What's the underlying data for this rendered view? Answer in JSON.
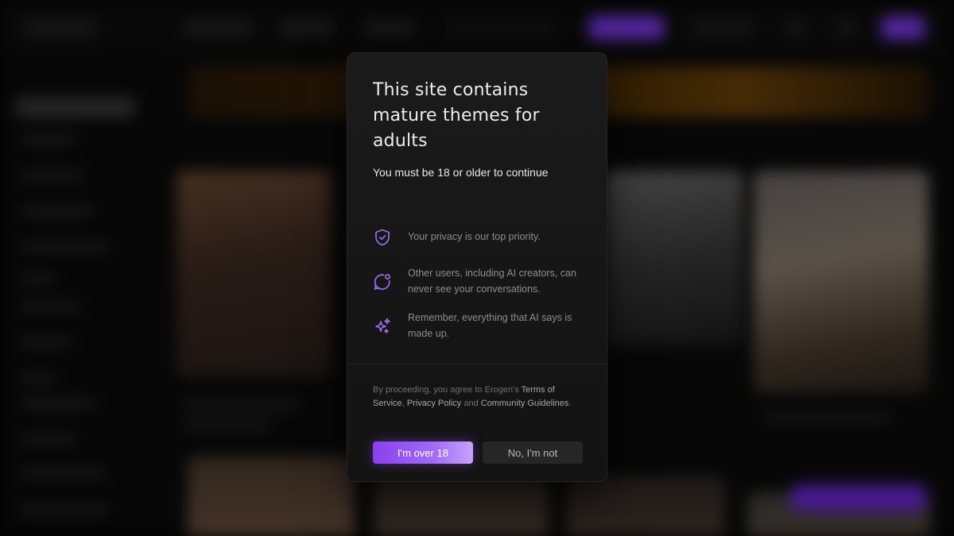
{
  "modal": {
    "title": "This site contains mature themes for adults",
    "subtitle": "You must be 18 or older to continue",
    "features": [
      {
        "icon": "shield-check-icon",
        "text": "Your privacy is our top priority."
      },
      {
        "icon": "chat-bubble-icon",
        "text": "Other users, including AI creators, can never see your conversations."
      },
      {
        "icon": "sparkles-icon",
        "text": "Remember, everything that AI says is made up."
      }
    ],
    "legal": {
      "prefix": "By proceeding, you agree to Erogen's ",
      "terms": "Terms of Service",
      "comma": ", ",
      "privacy": "Privacy Policy",
      "and": " and ",
      "guidelines": "Community Guidelines",
      "suffix": "."
    },
    "confirm_label": "I'm over 18",
    "decline_label": "No, I'm not"
  },
  "colors": {
    "accent": "#8b5cf6",
    "accent_gradient_end": "#c8a2fb",
    "modal_bg": "#181818",
    "icon": "#9b6bf2"
  }
}
